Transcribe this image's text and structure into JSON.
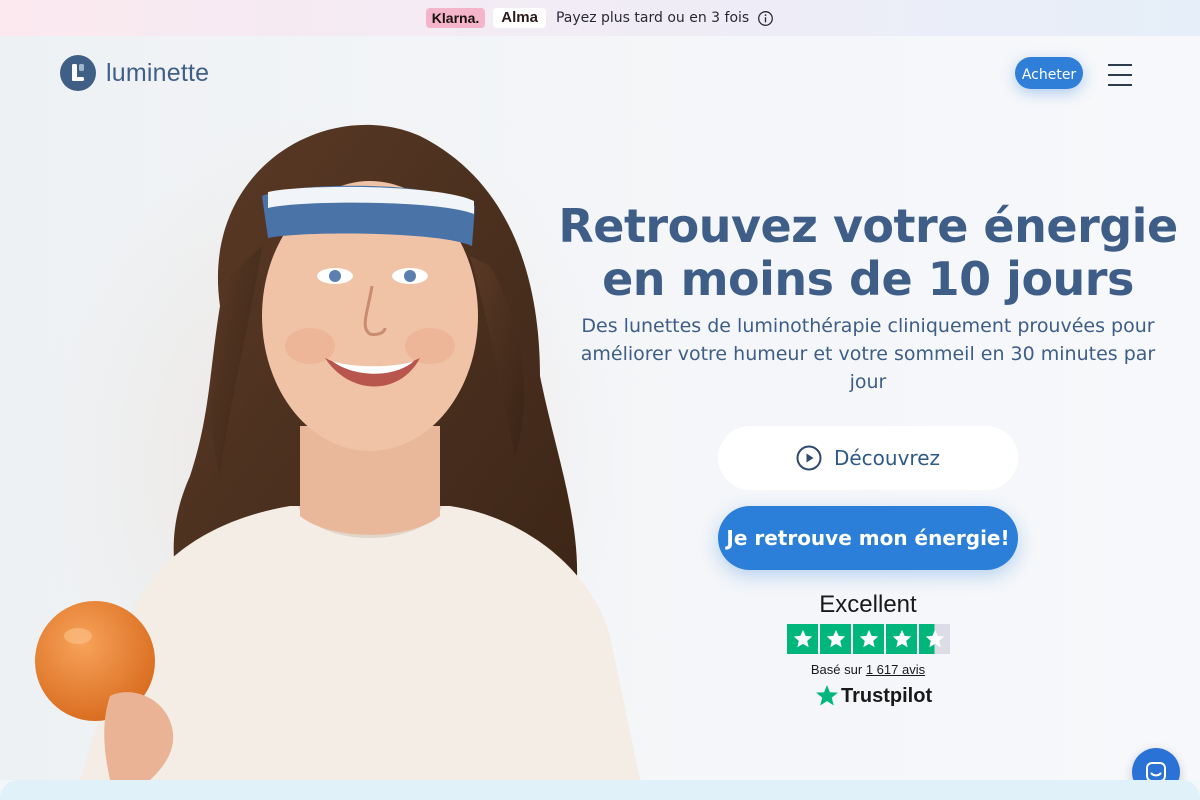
{
  "promo": {
    "klarna": "Klarna.",
    "alma": "Alma",
    "text": "Payez plus tard ou en 3 fois",
    "icon": "info-icon"
  },
  "header": {
    "logo_text": "luminette",
    "buy_label": "Acheter",
    "menu_icon": "hamburger-icon"
  },
  "hero": {
    "headline": "Retrouvez votre énergie en moins de 10 jours",
    "subhead": "Des lunettes de luminothérapie cliniquement prouvées pour améliorer votre humeur et votre sommeil en 30 minutes par jour",
    "discover_label": "Découvrez",
    "cta_label": "Je retrouve mon énergie!"
  },
  "trustpilot": {
    "rating_word": "Excellent",
    "stars": 4.5,
    "based_prefix": "Basé sur",
    "reviews_link": "1 617 avis",
    "brand": "Trustpilot"
  },
  "colors": {
    "primary": "#2b7fd8",
    "heading": "#3e5d87",
    "trustpilot_green": "#00b67a"
  }
}
